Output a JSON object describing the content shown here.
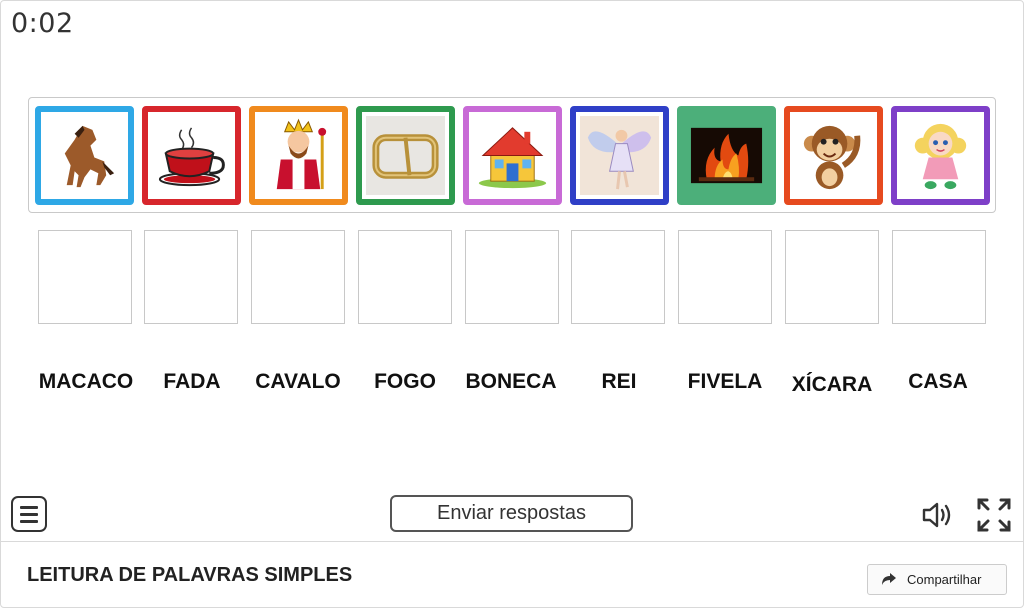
{
  "timer": {
    "value": "0:02"
  },
  "cards": [
    {
      "name": "horse",
      "border": "#2ea8e6"
    },
    {
      "name": "cup",
      "border": "#d7262c"
    },
    {
      "name": "king",
      "border": "#f08a1d"
    },
    {
      "name": "buckle",
      "border": "#2e9a4e"
    },
    {
      "name": "house",
      "border": "#c86ad6"
    },
    {
      "name": "fairy",
      "border": "#2f3fc7"
    },
    {
      "name": "fire",
      "border": "#4caf7a"
    },
    {
      "name": "monkey",
      "border": "#e64a1f"
    },
    {
      "name": "doll",
      "border": "#7e3fc8"
    }
  ],
  "words": [
    "MACACO",
    "FADA",
    "CAVALO",
    "FOGO",
    "BONECA",
    "REI",
    "FIVELA",
    "XÍCARA",
    "CASA"
  ],
  "toolbar": {
    "submit_label": "Enviar respostas"
  },
  "footer": {
    "title": "LEITURA DE PALAVRAS SIMPLES",
    "share_label": "Compartilhar"
  }
}
